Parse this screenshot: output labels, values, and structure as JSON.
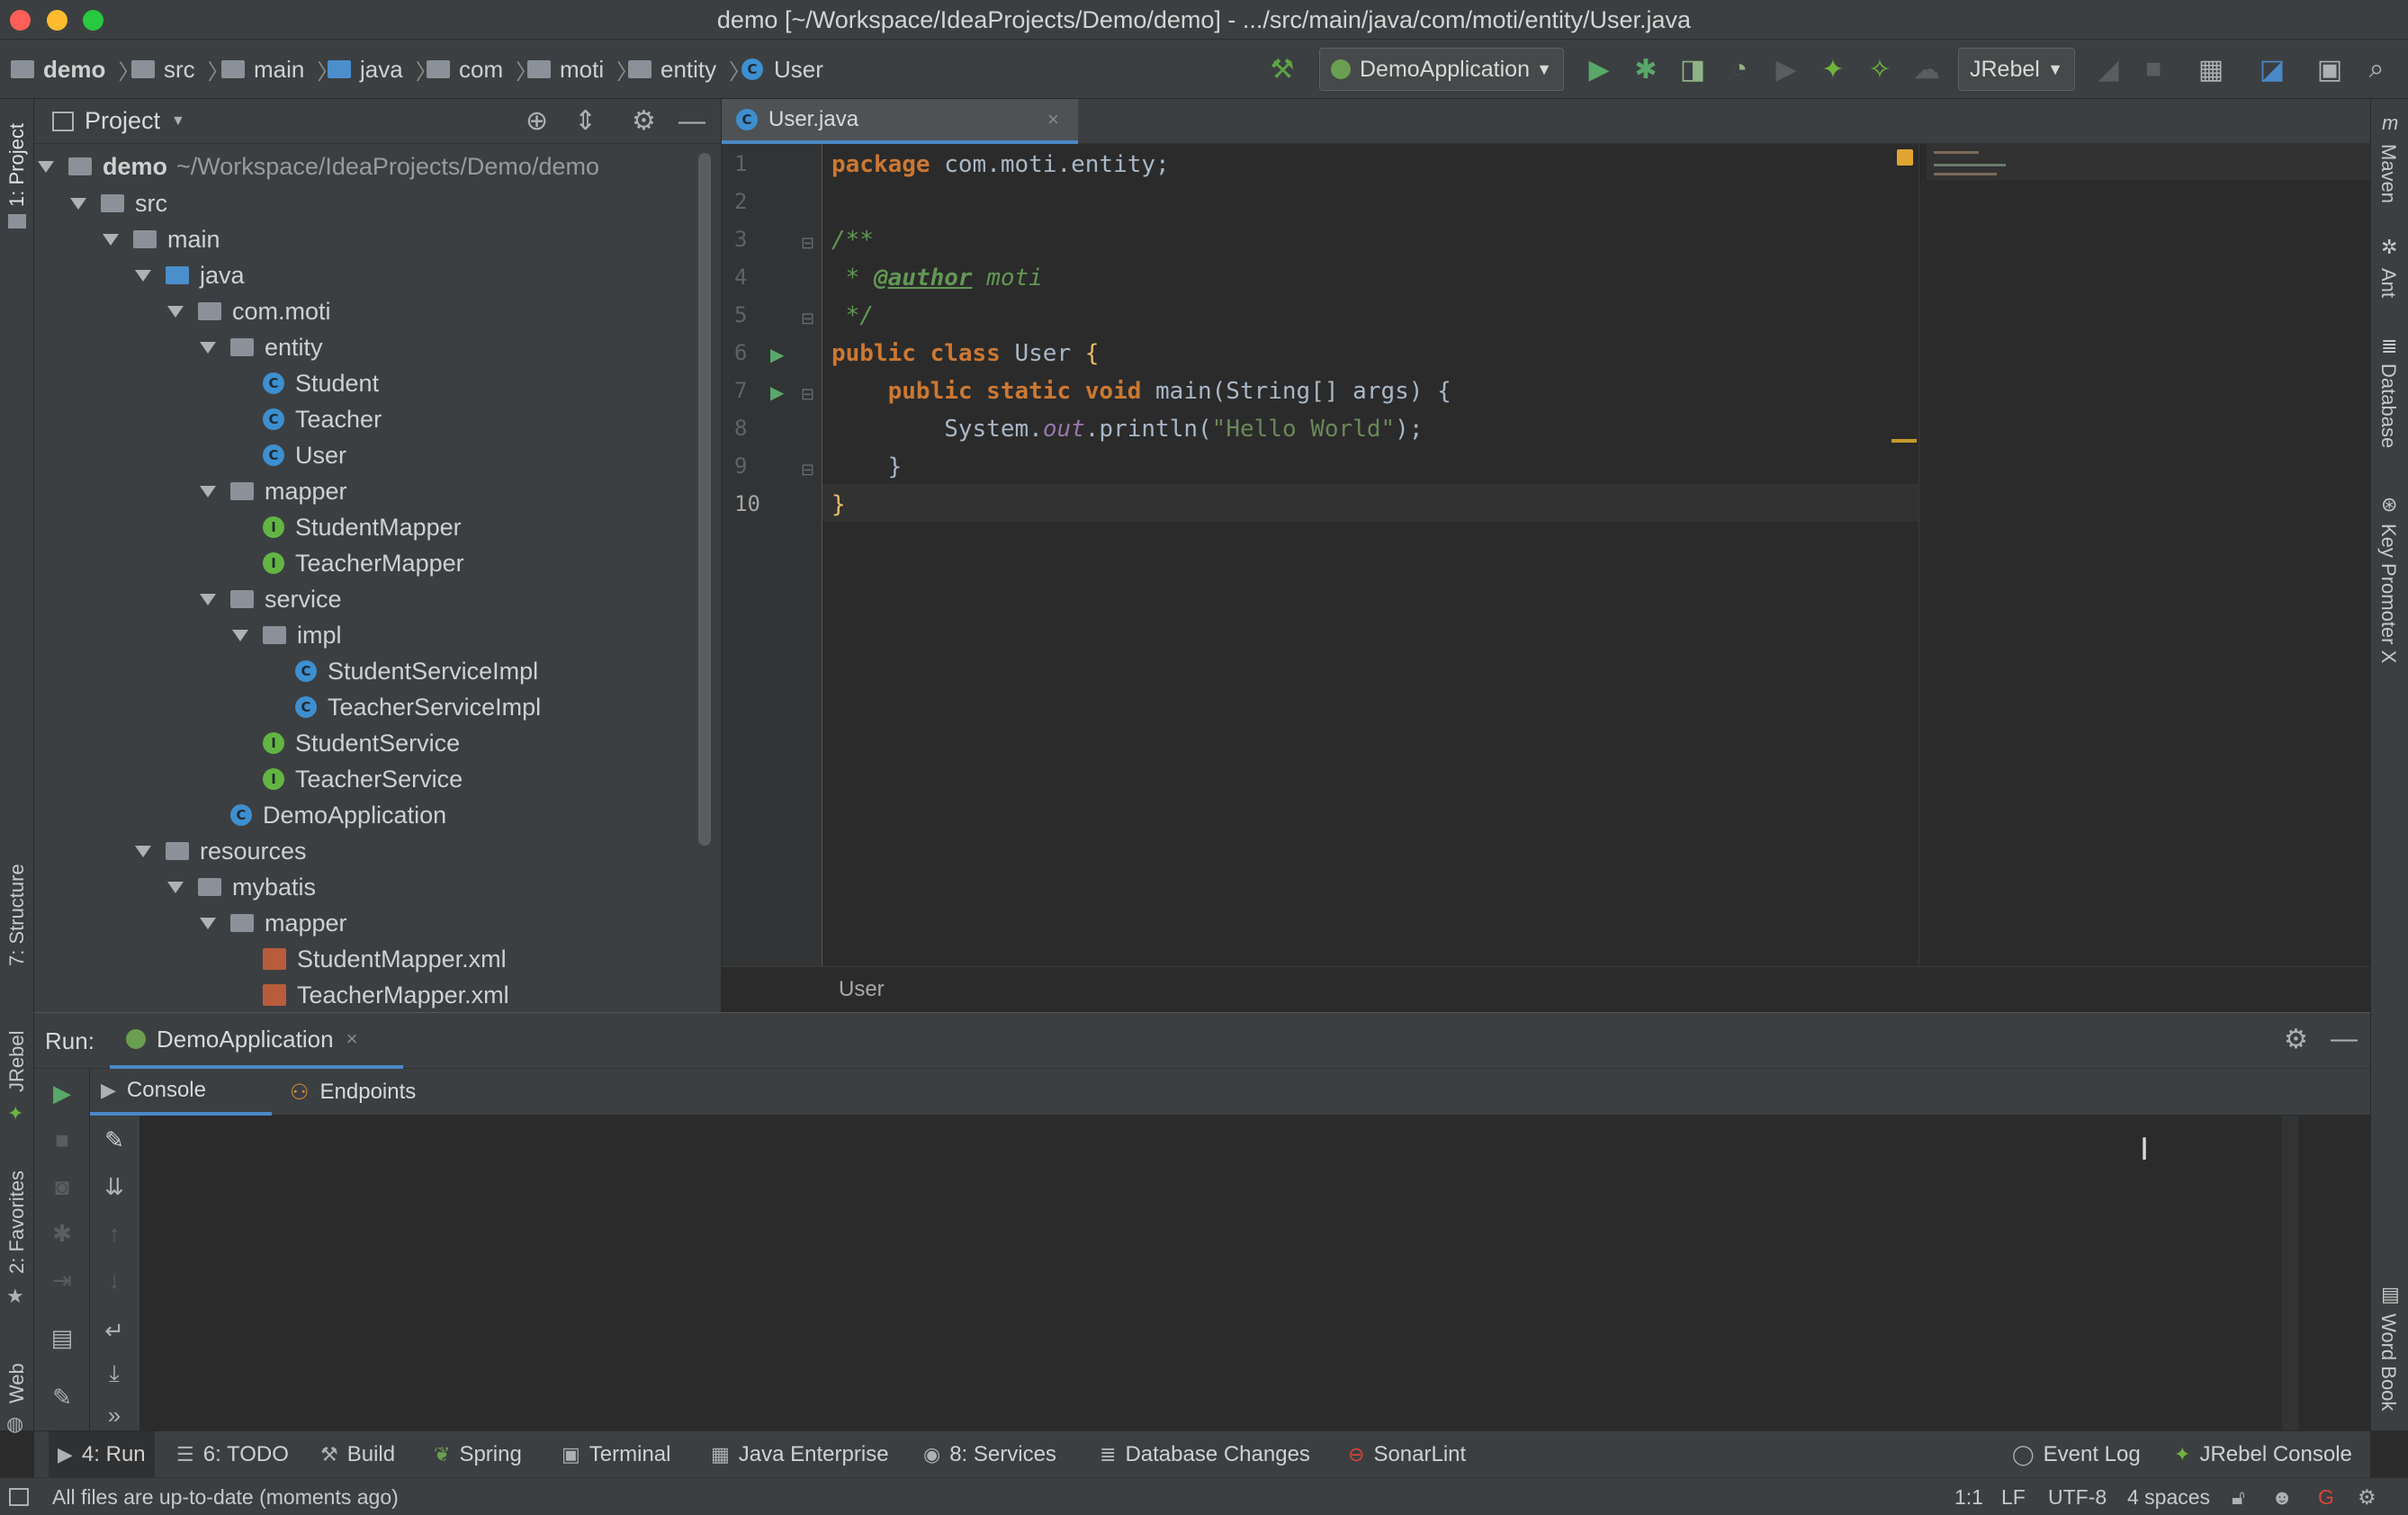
{
  "window": {
    "title": "demo [~/Workspace/IdeaProjects/Demo/demo] - .../src/main/java/com/moti/entity/User.java"
  },
  "breadcrumb": [
    {
      "label": "demo"
    },
    {
      "label": "src"
    },
    {
      "label": "main"
    },
    {
      "label": "java"
    },
    {
      "label": "com"
    },
    {
      "label": "moti"
    },
    {
      "label": "entity"
    },
    {
      "label": "User"
    }
  ],
  "toolbar": {
    "run_config": "DemoApplication",
    "jrebel_dropdown": "JRebel",
    "icons": [
      "hammer-icon",
      "run-icon",
      "debug-icon",
      "coverage-icon",
      "profiler-icon",
      "jrebel-run-icon",
      "jrebel-debug-icon",
      "stop-icon",
      "project-structure-icon",
      "translate-icon",
      "search-icon"
    ]
  },
  "left_strip": {
    "items": [
      "1: Project",
      "7: Structure",
      "JRebel",
      "2: Favorites",
      "Web"
    ]
  },
  "right_strip": {
    "items": [
      "Maven",
      "Ant",
      "Database",
      "Key Promoter X",
      "Word Book"
    ]
  },
  "project_panel": {
    "title": "Project",
    "root_name": "demo",
    "root_path": "~/Workspace/IdeaProjects/Demo/demo",
    "tree": [
      {
        "label": "src",
        "kind": "folder",
        "depth": 1,
        "expanded": true
      },
      {
        "label": "main",
        "kind": "folder",
        "depth": 2,
        "expanded": true
      },
      {
        "label": "java",
        "kind": "folder",
        "depth": 3,
        "expanded": true
      },
      {
        "label": "com.moti",
        "kind": "folder",
        "depth": 4,
        "expanded": true
      },
      {
        "label": "entity",
        "kind": "folder",
        "depth": 5,
        "expanded": true
      },
      {
        "label": "Student",
        "kind": "class",
        "depth": 6
      },
      {
        "label": "Teacher",
        "kind": "class",
        "depth": 6
      },
      {
        "label": "User",
        "kind": "class",
        "depth": 6
      },
      {
        "label": "mapper",
        "kind": "folder",
        "depth": 5,
        "expanded": true
      },
      {
        "label": "StudentMapper",
        "kind": "interface",
        "depth": 6
      },
      {
        "label": "TeacherMapper",
        "kind": "interface",
        "depth": 6
      },
      {
        "label": "service",
        "kind": "folder",
        "depth": 5,
        "expanded": true
      },
      {
        "label": "impl",
        "kind": "folder",
        "depth": 6,
        "expanded": true
      },
      {
        "label": "StudentServiceImpl",
        "kind": "class",
        "depth": 7
      },
      {
        "label": "TeacherServiceImpl",
        "kind": "class",
        "depth": 7
      },
      {
        "label": "StudentService",
        "kind": "interface",
        "depth": 6
      },
      {
        "label": "TeacherService",
        "kind": "interface",
        "depth": 6
      },
      {
        "label": "DemoApplication",
        "kind": "class",
        "depth": 5
      },
      {
        "label": "resources",
        "kind": "folder",
        "depth": 3,
        "expanded": true
      },
      {
        "label": "mybatis",
        "kind": "folder",
        "depth": 4,
        "expanded": true
      },
      {
        "label": "mapper",
        "kind": "folder",
        "depth": 5,
        "expanded": true
      },
      {
        "label": "StudentMapper.xml",
        "kind": "xml",
        "depth": 6
      },
      {
        "label": "TeacherMapper.xml",
        "kind": "xml",
        "depth": 6
      }
    ]
  },
  "editor": {
    "tab_label": "User.java",
    "breadcrumb": "User",
    "line_numbers": [
      "1",
      "2",
      "3",
      "4",
      "5",
      "6",
      "7",
      "8",
      "9",
      "10"
    ],
    "code": {
      "l1_kw": "package",
      "l1_rest": " com.moti.entity;",
      "l3": "/**",
      "l4_star": " * ",
      "l4_tag": "@author",
      "l4_name": " moti",
      "l5": " */",
      "l6_kw": "public class",
      "l6_name": " User ",
      "l6_brace": "{",
      "l7_kw": "    public static void",
      "l7_rest": " main(String[] args) {",
      "l8_sys": "        System.",
      "l8_out": "out",
      "l8_call": ".println(",
      "l8_str": "\"Hello World\"",
      "l8_end": ");",
      "l9": "    }",
      "l10": "}"
    }
  },
  "run_panel": {
    "label": "Run:",
    "config_tab": "DemoApplication",
    "subtabs": [
      "Console",
      "Endpoints"
    ]
  },
  "bottom_tools": [
    {
      "label": "4: Run",
      "icon": "run-icon"
    },
    {
      "label": "6: TODO",
      "icon": "list-icon"
    },
    {
      "label": "Build",
      "icon": "hammer-icon"
    },
    {
      "label": "Spring",
      "icon": "spring-icon"
    },
    {
      "label": "Terminal",
      "icon": "terminal-icon"
    },
    {
      "label": "Java Enterprise",
      "icon": "enterprise-icon"
    },
    {
      "label": "8: Services",
      "icon": "services-icon"
    },
    {
      "label": "Database Changes",
      "icon": "db-changes-icon"
    },
    {
      "label": "SonarLint",
      "icon": "sonarlint-icon"
    },
    {
      "label": "Event Log",
      "icon": "event-log-icon"
    },
    {
      "label": "JRebel Console",
      "icon": "jrebel-icon"
    }
  ],
  "status_bar": {
    "message": "All files are up-to-date (moments ago)",
    "position": "1:1",
    "line_sep": "LF",
    "encoding": "UTF-8",
    "indent": "4 spaces"
  },
  "colors": {
    "accent": "#4a88c7",
    "keyword": "#cc7832",
    "string": "#6a8759",
    "comment": "#629755"
  }
}
